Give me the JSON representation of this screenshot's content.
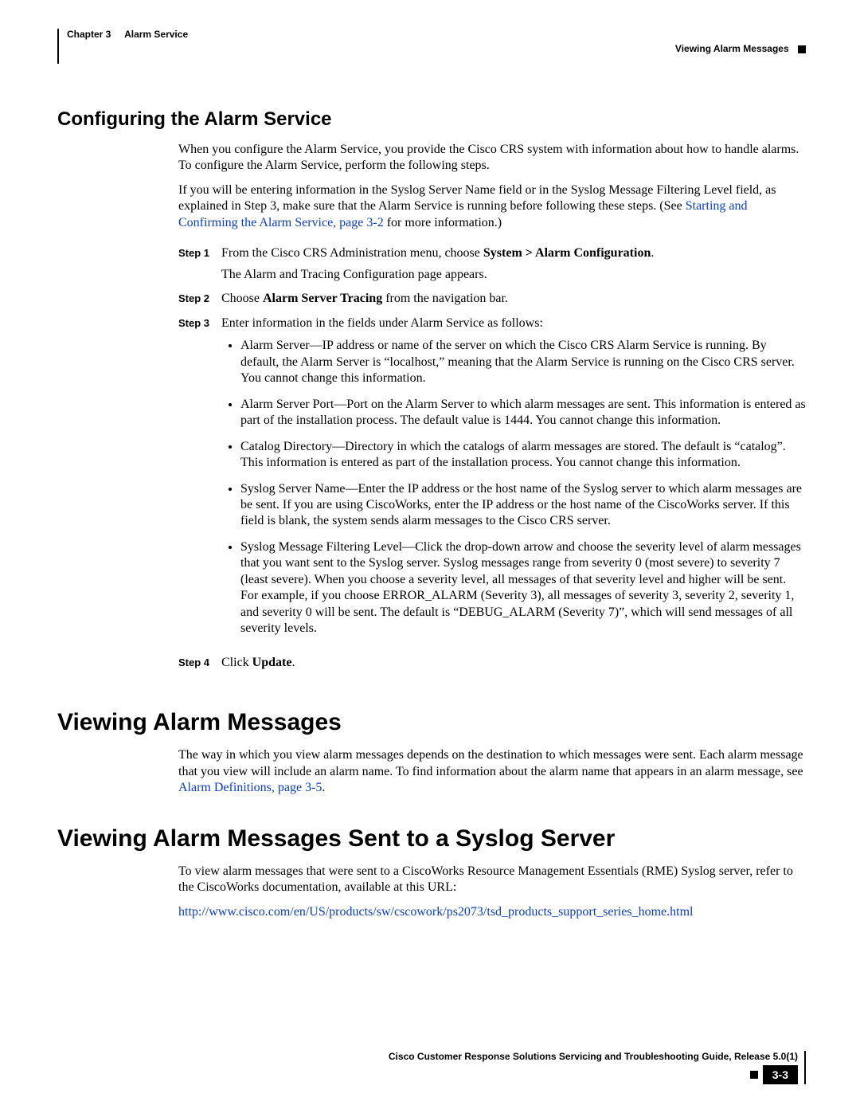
{
  "header": {
    "chapter_label": "Chapter 3",
    "chapter_title": "Alarm Service",
    "right": "Viewing Alarm Messages"
  },
  "section1": {
    "title": "Configuring the Alarm Service",
    "p1": "When you configure the Alarm Service, you provide the Cisco CRS system with information about how to handle alarms. To configure the Alarm Service, perform the following steps.",
    "p2a": "If you will be entering information in the Syslog Server Name field or in the Syslog Message Filtering Level field, as explained in Step 3, make sure that the Alarm Service is running before following these steps. (See ",
    "p2_link": "Starting and Confirming the Alarm Service, page 3-2",
    "p2b": " for more information.)",
    "steps": {
      "s1_label": "Step 1",
      "s1a": "From the Cisco CRS Administration menu, choose ",
      "s1b": "System > Alarm Configuration",
      "s1c": ".",
      "s1_sub": "The Alarm and Tracing Configuration page appears.",
      "s2_label": "Step 2",
      "s2a": "Choose ",
      "s2b": "Alarm Server Tracing",
      "s2c": " from the navigation bar.",
      "s3_label": "Step 3",
      "s3_intro": "Enter information in the fields under Alarm Service as follows:",
      "s3_bullets": [
        "Alarm Server—IP address or name of the server on which the Cisco CRS Alarm Service is running. By default, the Alarm Server is “localhost,” meaning that the Alarm Service is running on the Cisco CRS server. You cannot change this information.",
        "Alarm Server Port—Port on the Alarm Server to which alarm messages are sent. This information is entered as part of the installation process. The default value is 1444. You cannot change this information.",
        "Catalog Directory—Directory in which the catalogs of alarm messages are stored. The default is “catalog”. This information is entered as part of the installation process. You cannot change this information.",
        "Syslog Server Name—Enter the IP address or the host name of the Syslog server to which alarm messages are be sent. If you are using CiscoWorks, enter the IP address or the host name of the CiscoWorks server. If this field is blank, the system sends alarm messages to the Cisco CRS server.",
        "Syslog Message Filtering Level—Click the drop-down arrow and choose the severity level of alarm messages that you want sent to the Syslog server. Syslog messages range from severity 0 (most severe) to severity 7 (least severe). When you choose a severity level, all messages of that severity level and higher will be sent. For example, if you choose ERROR_ALARM (Severity 3), all messages of severity 3, severity 2, severity 1, and severity 0 will be sent. The default is “DEBUG_ALARM (Severity 7)”, which will send messages of all severity levels."
      ],
      "s4_label": "Step 4",
      "s4a": "Click ",
      "s4b": "Update",
      "s4c": "."
    }
  },
  "section2": {
    "title": "Viewing Alarm Messages",
    "p1a": "The way in which you view alarm messages depends on the destination to which messages were sent. Each alarm message that you view will include an alarm name. To find information about the alarm name that appears in an alarm message, see ",
    "p1_link": "Alarm Definitions, page 3-5",
    "p1b": "."
  },
  "section3": {
    "title": "Viewing Alarm Messages Sent to a Syslog Server",
    "p1": "To view alarm messages that were sent to a CiscoWorks Resource Management Essentials (RME) Syslog server, refer to the CiscoWorks documentation, available at this URL:",
    "url": "http://www.cisco.com/en/US/products/sw/cscowork/ps2073/tsd_products_support_series_home.html"
  },
  "footer": {
    "title": "Cisco Customer Response Solutions Servicing and Troubleshooting Guide, Release 5.0(1)",
    "page": "3-3"
  }
}
